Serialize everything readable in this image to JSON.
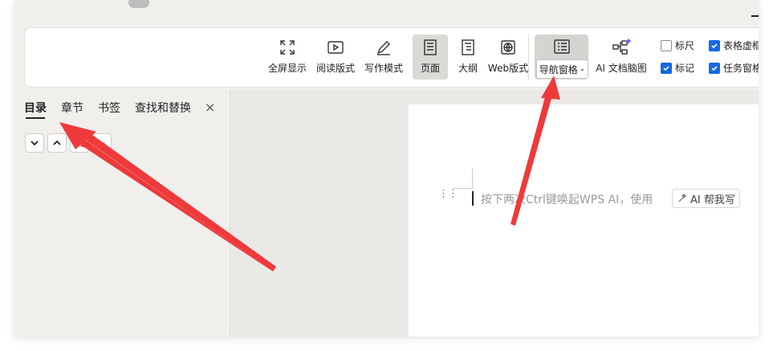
{
  "ribbon": {
    "buttons": [
      {
        "label": "全屏显示",
        "icon": "fullscreen-icon"
      },
      {
        "label": "阅读版式",
        "icon": "read-mode-icon"
      },
      {
        "label": "写作模式",
        "icon": "pen-icon"
      },
      {
        "label": "页面",
        "icon": "page-view-icon",
        "active": true
      },
      {
        "label": "大纲",
        "icon": "outline-icon"
      },
      {
        "label": "Web版式",
        "icon": "globe-icon"
      }
    ],
    "nav_pane_label": "导航窗格",
    "ai_mindmap_label": "AI 文档脑图",
    "checkboxes": [
      {
        "label": "标尺",
        "checked": false
      },
      {
        "label": "表格虚框",
        "checked": true
      },
      {
        "label": "标记",
        "checked": true
      },
      {
        "label": "任务窗格",
        "checked": true
      }
    ]
  },
  "nav_panel": {
    "tabs": [
      "目录",
      "章节",
      "书签",
      "查找和替换"
    ],
    "close": "×"
  },
  "document": {
    "hint": "按下两次Ctrl键唤起WPS AI，使用",
    "ai_button": "AI 帮我写"
  },
  "colors": {
    "accent": "#1668e3",
    "arrow": "#ee3a3a"
  }
}
